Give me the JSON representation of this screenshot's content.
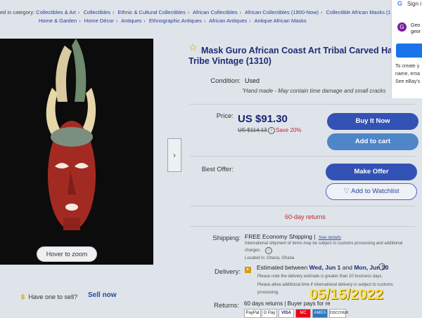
{
  "breadcrumbs": {
    "label": "ed in category:",
    "row1": [
      "Collectibles & Art",
      "Collectibles",
      "Ethnic & Cultural Collectibles",
      "African Collectibles",
      "African Collectibles (1900-Now)",
      "Collectible African Masks (1900"
    ],
    "row2": [
      "Home & Garden",
      "Home Décor",
      "Antiques",
      "Ethnographic Antiques",
      "African Antiques",
      "Antique African Masks"
    ]
  },
  "gallery": {
    "zoom_label": "Hover to zoom",
    "next_icon": "chevron-right-icon"
  },
  "listing": {
    "title_line1": "Mask Guro African Coast Art Tribal Carved Hand W",
    "title_line2": "Tribe Vintage (1310)",
    "condition_label": "Condition:",
    "condition_value": "Used",
    "condition_note": "“Hand made - May contain time damage and small cracks",
    "price_label": "Price:",
    "price": "US $91.30",
    "old_price": "US $114.13",
    "save": "Save 20%",
    "buy_now": "Buy It Now",
    "add_to_cart": "Add to cart",
    "best_offer_label": "Best Offer:",
    "make_offer": "Make Offer",
    "add_watchlist": "Add to Watchlist",
    "returns_highlight": "60-day returns"
  },
  "shipping": {
    "label": "Shipping:",
    "value": "FREE Economy Shipping |",
    "details_link": "See details",
    "note1": "International shipment of items may be subject to customs processing and additional",
    "note2": "charges.",
    "location": "Located in: Ghana, Ghana"
  },
  "delivery": {
    "label": "Delivery:",
    "estimate_prefix": "Estimated between",
    "date1": "Wed, Jun 1",
    "and": "and",
    "date2": "Mon, Jun 20",
    "note1": "Please note the delivery estimate is greater than 10 business days.",
    "note2": "Please allow additional time if international delivery is subject to customs",
    "note3": "processing."
  },
  "returns": {
    "label": "Returns:",
    "value": "60 days returns | Buyer pays for re"
  },
  "payments": [
    "PayPal",
    "G Pay",
    "VISA",
    "MC",
    "AMEX",
    "DISCOVER"
  ],
  "sell": {
    "prompt": "Have one to sell?",
    "link": "Sell now"
  },
  "date_stamp": "05/15/2022",
  "google_popup": {
    "title": "Sign i",
    "avatar_letter": "G",
    "account_name": "Geo",
    "account_email": "geor",
    "text_line1": "To create y",
    "text_line2": "name, ema",
    "text_line3": "See eBay's"
  }
}
